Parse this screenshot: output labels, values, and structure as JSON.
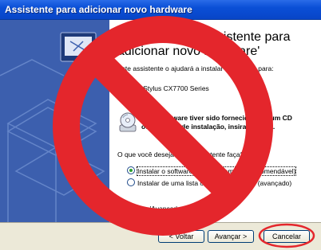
{
  "window": {
    "title": "Assistente para adicionar novo hardware"
  },
  "wizard": {
    "heading": "Bem-vindo ao 'Assistente para adicionar novo hardware'",
    "intro": "Este assistente o ajudará a instalar o software para:",
    "device": "EPSON Stylus CX7700 Series",
    "cd_hint_line1": "Se o hardware tiver sido fornecido com um CD",
    "cd_hint_line2": "ou disquete de instalação, insira-o agora.",
    "question": "O que você deseja que o assistente faça?",
    "options": [
      {
        "label": "Instalar o software automaticamente (recomendável)",
        "selected": true
      },
      {
        "label": "Instalar de uma lista ou local específico (avançado)",
        "selected": false
      }
    ],
    "continue_hint": "Clique em 'Avançar' para continuar."
  },
  "buttons": {
    "back": "< Voltar",
    "next": "Avançar >",
    "cancel": "Cancelar"
  },
  "colors": {
    "prohibition_red": "#e4262c",
    "title_blue": "#0a4fd6",
    "sidebar_blue": "#3c5fae",
    "radio_green": "#2ea02e"
  }
}
